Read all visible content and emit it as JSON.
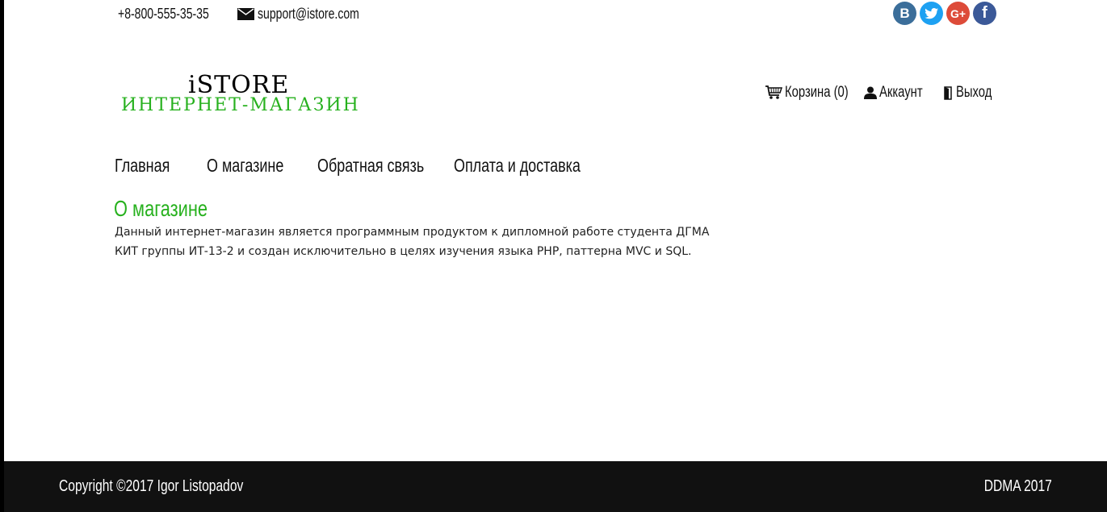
{
  "topbar": {
    "phone": "+8-800-555-35-35",
    "email": "support@istore.com"
  },
  "social": [
    {
      "name": "vk-icon",
      "label": "B",
      "color": "#3b6e9a"
    },
    {
      "name": "twitter-icon",
      "label": "t",
      "color": "#1da1f2"
    },
    {
      "name": "google-plus-icon",
      "label": "G+",
      "color": "#dd4b39"
    },
    {
      "name": "facebook-icon",
      "label": "f",
      "color": "#3b5998"
    }
  ],
  "logo": {
    "line1": "iSTORE",
    "line2": "ИНТЕРНЕТ-МАГАЗИН"
  },
  "usernav": {
    "cart": "Корзина (0)",
    "account": "Аккаунт",
    "logout": "Выход"
  },
  "mainnav": [
    "Главная",
    "О магазине",
    "Обратная связь",
    "Оплата и доставка"
  ],
  "content": {
    "heading": "О магазине",
    "text": "Данный интернет-магазин является программным продуктом к дипломной работе студента ДГМА КИТ группы ИТ-13-2 и создан исключительно в целях изучения языка PHP, паттерна MVC и SQL."
  },
  "footer": {
    "copyright": "Copyright ©2017 Igor Listopadov",
    "ddma": "DDMA 2017"
  },
  "colors": {
    "accent": "#27b11e",
    "footer_bg": "#111111"
  }
}
